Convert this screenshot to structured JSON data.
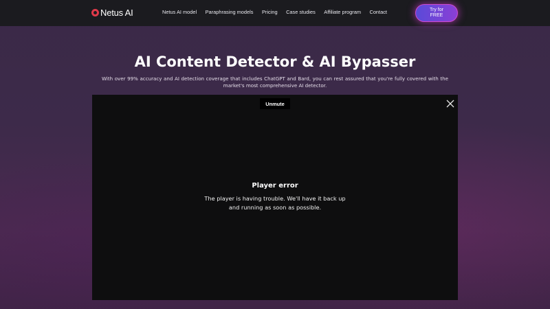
{
  "header": {
    "logo_text": "Netus AI",
    "nav": [
      {
        "label": "Netus AI model"
      },
      {
        "label": "Paraphrasing models"
      },
      {
        "label": "Pricing"
      },
      {
        "label": "Case studies"
      },
      {
        "label": "Affiliate program"
      },
      {
        "label": "Contact"
      }
    ],
    "cta_label": "Try for\nFREE"
  },
  "hero": {
    "title": "AI Content Detector & AI Bypasser",
    "subtitle": "With over 99% accuracy and AI detection coverage that includes ChatGPT and Bard, you can rest assured that you're fully covered with the market's most comprehensive AI detector."
  },
  "player": {
    "unmute_label": "Unmute",
    "error_title": "Player error",
    "error_message": "The player is having trouble. We'll have it back up and running as soon as possible."
  },
  "icons": {
    "logo": "netus-logo-icon",
    "close": "close-icon"
  },
  "colors": {
    "header_bg": "#1b1b1f",
    "page_bg": "#3d2a4a",
    "cta_gradient_start": "#5a4ad8",
    "cta_gradient_end": "#8a3fd6",
    "cta_glow": "#d04ad0",
    "logo_accent": "#e03a4a",
    "player_bg": "#0e0e0f"
  }
}
